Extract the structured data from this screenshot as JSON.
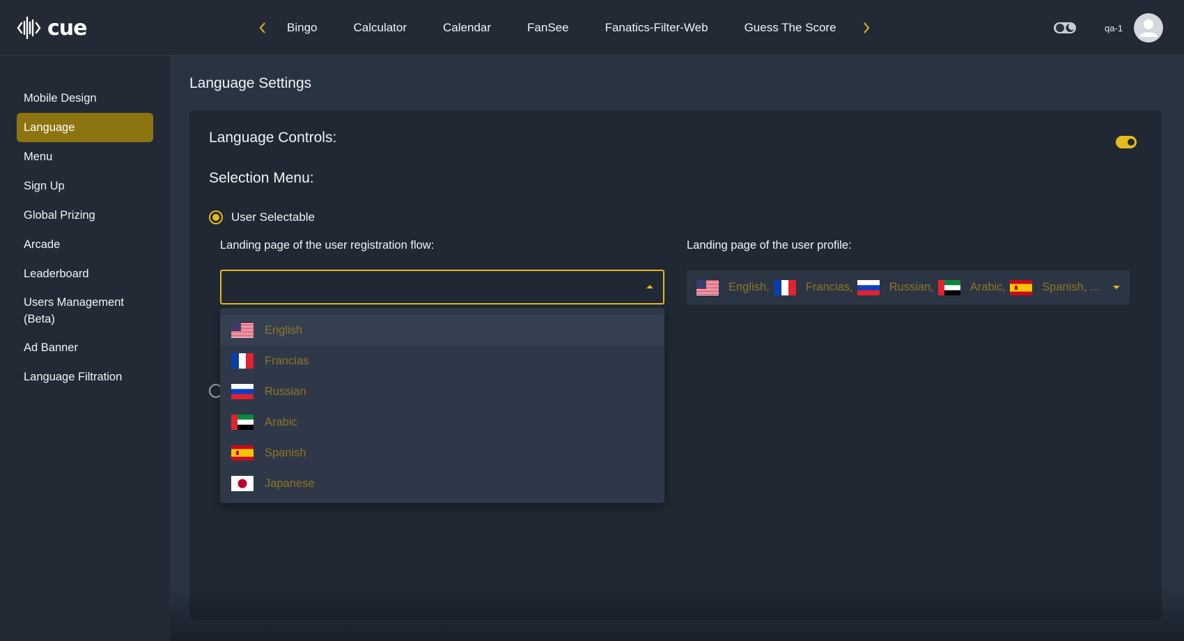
{
  "app": {
    "brand": "cue",
    "accent_color": "#e8b91d"
  },
  "topbar": {
    "prev_icon": "chevron-left-icon",
    "next_icon": "chevron-right-icon",
    "tabs": [
      {
        "label": "Bingo"
      },
      {
        "label": "Calculator"
      },
      {
        "label": "Calendar"
      },
      {
        "label": "FanSee"
      },
      {
        "label": "Fanatics-Filter-Web"
      },
      {
        "label": "Guess The Score"
      }
    ],
    "theme_toggle_icon": "theme-toggle-icon",
    "username": "qa-1",
    "avatar_icon": "user-avatar-icon"
  },
  "sidebar": {
    "items": [
      {
        "label": "Mobile Design",
        "active": false
      },
      {
        "label": "Language",
        "active": true
      },
      {
        "label": "Menu",
        "active": false
      },
      {
        "label": "Sign Up",
        "active": false
      },
      {
        "label": "Global Prizing",
        "active": false
      },
      {
        "label": "Arcade",
        "active": false
      },
      {
        "label": "Leaderboard",
        "active": false
      },
      {
        "label": "Users Management (Beta)",
        "active": false
      },
      {
        "label": "Ad Banner",
        "active": false
      },
      {
        "label": "Language Filtration",
        "active": false
      }
    ]
  },
  "main": {
    "page_title": "Language Settings",
    "controls_heading": "Language Controls:",
    "controls_enabled": true,
    "selection_heading": "Selection Menu:",
    "radio_user_selectable": {
      "label": "User Selectable",
      "checked": true
    },
    "registration": {
      "label": "Landing page of the user registration flow:",
      "value": "",
      "open": true,
      "options": [
        {
          "label": "English",
          "flag": "us-flag-icon"
        },
        {
          "label": "Francias",
          "flag": "france-flag-icon"
        },
        {
          "label": "Russian",
          "flag": "russia-flag-icon"
        },
        {
          "label": "Arabic",
          "flag": "uae-flag-icon"
        },
        {
          "label": "Spanish",
          "flag": "spain-flag-icon"
        },
        {
          "label": "Japanese",
          "flag": "japan-flag-icon"
        }
      ]
    },
    "profile": {
      "label": "Landing page of the user profile:",
      "selected": [
        {
          "label": "English,",
          "flag": "us-flag-icon"
        },
        {
          "label": "Francias,",
          "flag": "france-flag-icon"
        },
        {
          "label": "Russian,",
          "flag": "russia-flag-icon"
        },
        {
          "label": "Arabic,",
          "flag": "uae-flag-icon"
        },
        {
          "label": "Spanish, ...",
          "flag": "spain-flag-icon"
        }
      ]
    }
  }
}
